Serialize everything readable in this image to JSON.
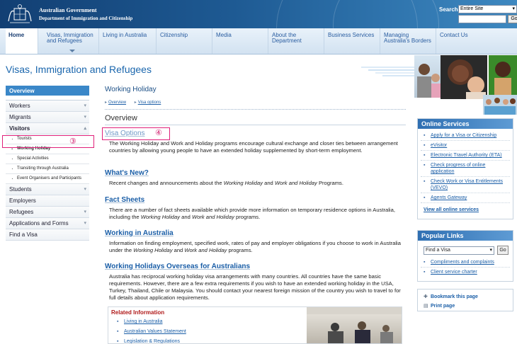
{
  "header": {
    "gov_name": "Australian Government",
    "dept_name": "Department of Immigration and Citizenship",
    "search_label": "Search",
    "search_scope": "Entire Site",
    "search_go": "Go"
  },
  "nav": [
    {
      "label": "Home"
    },
    {
      "label": "Visas, Immigration and Refugees"
    },
    {
      "label": "Living in Australia"
    },
    {
      "label": "Citizenship"
    },
    {
      "label": "Media"
    },
    {
      "label": "About the Department"
    },
    {
      "label": "Business Services"
    },
    {
      "label": "Managing Australia's Borders"
    },
    {
      "label": "Contact Us"
    }
  ],
  "page_title": "Visas, Immigration and Refugees",
  "left_nav": {
    "overview": "Overview",
    "items": {
      "workers": "Workers",
      "migrants": "Migrants",
      "visitors": "Visitors",
      "tourists": "Tourists",
      "working_holiday": "Working Holiday",
      "special_activities": "Special Activities",
      "transiting": "Transiting through Australia",
      "event_organisers": "Event Organisers and Participants",
      "students": "Students",
      "employers": "Employers",
      "refugees": "Refugees",
      "applications": "Applications and Forms",
      "find_visa": "Find a Visa"
    }
  },
  "callouts": {
    "three": "③",
    "four": "④"
  },
  "main": {
    "section_name": "Working Holiday",
    "breadcrumbs": [
      "Overview",
      "Visa options"
    ],
    "overview_heading": "Overview",
    "visa_options": {
      "title": "Visa Options",
      "text": "The Working Holiday and Work and Holiday programs encourage cultural exchange and closer ties between arrangement countries by allowing young people to have an extended holiday supplemented by short-term employment."
    },
    "whats_new": {
      "title": "What's New?",
      "text_a": "Recent changes and announcements about the ",
      "text_b": "Working Holiday",
      "text_c": " and ",
      "text_d": "Work and Holiday",
      "text_e": " Programs."
    },
    "fact_sheets": {
      "title": "Fact Sheets",
      "text_a": "There are a number of fact sheets available which provide more information on temporary residence options in Australia, including the ",
      "text_b": "Working Holiday",
      "text_c": " and ",
      "text_d": "Work and Holiday",
      "text_e": " programs."
    },
    "working_in_aus": {
      "title": "Working in Australia",
      "text_a": "Information on finding employment, specified work, rates of pay and employer obligations if you choose to work in Australia under the ",
      "text_b": "Working Holiday",
      "text_c": " and ",
      "text_d": "Work and Holiday",
      "text_e": " programs."
    },
    "overseas": {
      "title": "Working Holidays Overseas for Australians",
      "text": "Australia has reciprocal working holiday visa arrangements with many countries. All countries have the same basic requirements. However, there are a few extra requirements if you wish to have an extended working holiday in the USA, Turkey, Thailand, Chile or Malaysia. You should contact your nearest foreign mission of the country you wish to travel to for full details about application requirements."
    },
    "related": {
      "title": "Related Information",
      "links": [
        "Living in Australia",
        "Australian Values Statement",
        "Legislation & Regulations"
      ]
    }
  },
  "online_services": {
    "title": "Online Services",
    "links": [
      "Apply for a Visa or Citizenship",
      "eVisitor",
      "Electronic Travel Authority (ETA)",
      "Check progress of online application",
      "Check Work or Visa Entitlements (VEVO)",
      "Agents Gateway"
    ],
    "view_all": "View all online services"
  },
  "popular_links": {
    "title": "Popular Links",
    "select_value": "Find a Visa",
    "go": "Go",
    "links": [
      "Compliments and complaints",
      "Client service charter"
    ]
  },
  "tools": {
    "bookmark": "Bookmark this page",
    "print": "Print page"
  },
  "colors": {
    "accent": "#1a66ad",
    "header_dark": "#123f73",
    "callout": "#e0207a"
  }
}
